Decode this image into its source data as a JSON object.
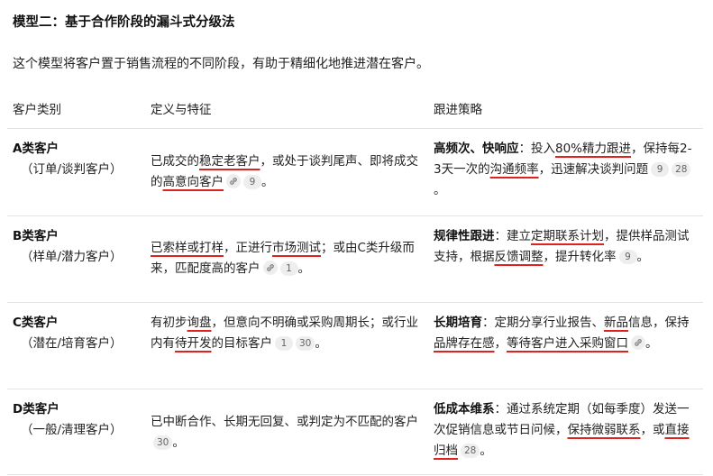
{
  "heading": "模型二：基于合作阶段的漏斗式分级法",
  "intro": "这个模型将客户置于销售流程的不同阶段，有助于精细化地推进潜在客户。",
  "headers": {
    "category": "客户类别",
    "definition": "定义与特征",
    "strategy": "跟进策略"
  },
  "rows": [
    {
      "name": "A类客户",
      "sub": "（订单/谈判客户）",
      "def": {
        "t1": "已成交的",
        "u1": "稳定老客户",
        "t2": "，或处于谈判尾声、即将成交的",
        "u2": "高意向客户",
        "c1": "9",
        "t3": "。"
      },
      "stg": {
        "lead": "高频次、快响应",
        "t1": "：投入",
        "u1": "80%精力跟进",
        "t2": "，保持每2-3天一次的",
        "u2": "沟通频率",
        "t3": "，迅速解决谈判问题",
        "c1": "9",
        "c2": "28",
        "t4": "。"
      }
    },
    {
      "name": "B类客户",
      "sub": "（样单/潜力客户）",
      "def": {
        "u1": "已索样或打样",
        "t1": "，正进行",
        "u2": "市场测试",
        "t2": "；或由C类升级而来，匹配度高的客户",
        "c1": "1",
        "t3": "。"
      },
      "stg": {
        "lead": "规律性跟进",
        "t1": "：建立",
        "u1": "定期联系计划",
        "t2": "，提供样品测试支持，根据",
        "u2": "反馈调整",
        "t3": "，提升转化率",
        "c1": "9",
        "t4": "。"
      }
    },
    {
      "name": "C类客户",
      "sub": "（潜在/培育客户）",
      "def": {
        "t1": "有初步",
        "u1": "询盘",
        "t2": "，但意向不明确或采购周期长；或行业内有",
        "u2": "待开发",
        "t3": "的目标客户",
        "c1": "1",
        "c2": "30",
        "t4": "。"
      },
      "stg": {
        "lead": "长期培育",
        "t1": "：定期分享行业报告、",
        "u1": "新品",
        "t2": "信息，保持",
        "u2": "品牌存在感",
        "t3": "，",
        "u3": "等待客户进入采购窗口",
        "t4": "。"
      }
    },
    {
      "name": "D类客户",
      "sub": "（一般/清理客户）",
      "def": {
        "t1": "已中断合作、长期无回复、或判定为不匹配的客户",
        "c1": "30",
        "t2": "。"
      },
      "stg": {
        "lead": "低成本维系",
        "t1": "：通过系统定期（如每季度）发送一次促销信息或节日问候，",
        "u1": "保持微弱联系",
        "t2": "，或",
        "u2": "直接归档",
        "c1": "28",
        "t3": "。"
      }
    }
  ],
  "colors": {
    "annotation": "#e0221f",
    "rule": "#e3e3e3",
    "citation_bg": "#eeeeee"
  },
  "icons": [
    "link-icon"
  ]
}
